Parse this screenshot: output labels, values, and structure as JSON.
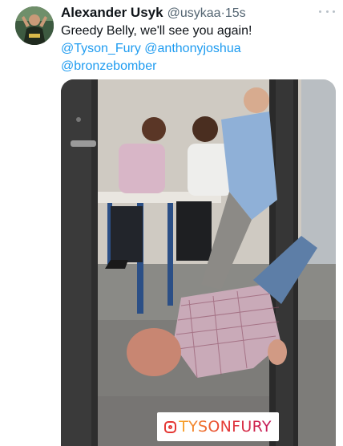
{
  "tweet": {
    "author_name": "Alexander Usyk",
    "handle": "@usykaa",
    "separator": "·",
    "time": "15s",
    "text_line1": "Greedy Belly, we'll see you again!",
    "mentions": [
      "@Tyson_Fury",
      "@anthonyjoshua",
      "@bronzebomber"
    ]
  },
  "media": {
    "watermark_text": "TYSONFURY",
    "icon": "instagram-icon"
  },
  "icons": {
    "more": "more-dots-icon",
    "avatar": "avatar"
  }
}
